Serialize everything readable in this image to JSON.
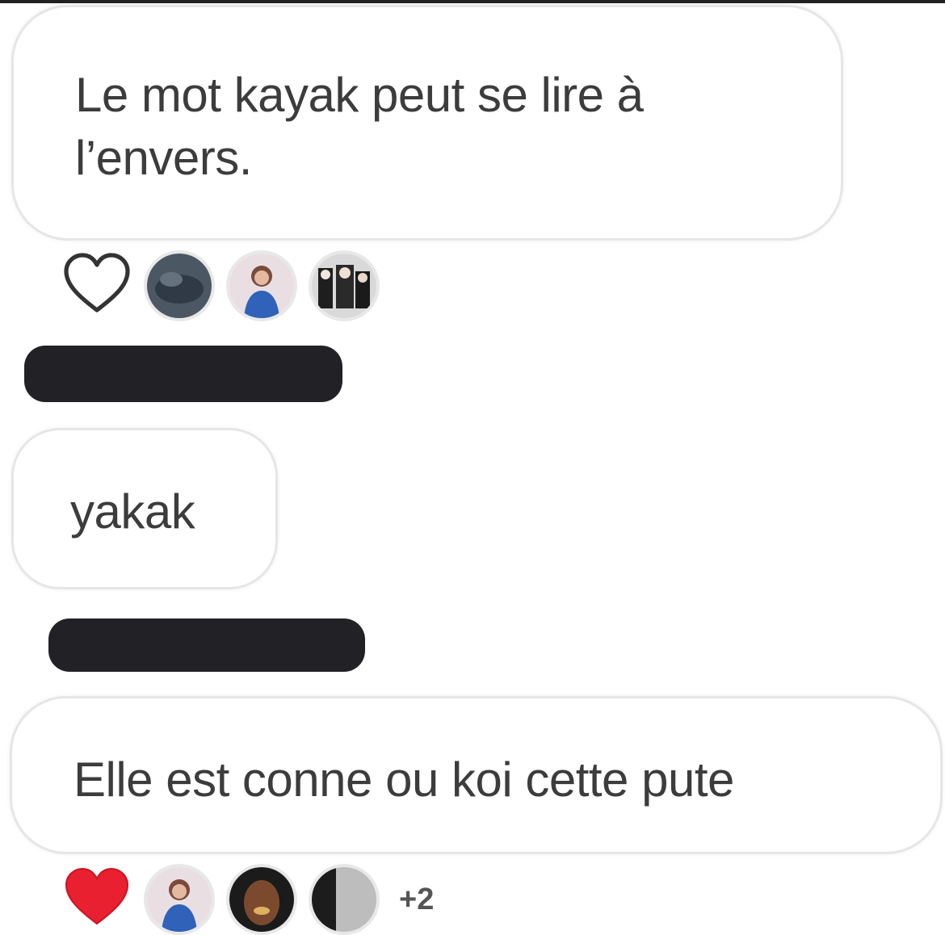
{
  "messages": [
    {
      "text": "Le mot kayak peut se lire à l’envers."
    },
    {
      "text": "yakak"
    },
    {
      "text": "Elle est conne ou koi cette pute"
    }
  ],
  "reactions": {
    "first": {
      "heart": "heart-outline-icon",
      "liked": false
    },
    "last": {
      "heart": "heart-filled-icon",
      "liked": true,
      "extra_count": "+2"
    }
  },
  "colors": {
    "heart_red": "#e8202f",
    "redaction": "#222226",
    "bubble_border": "#e6e6e6"
  }
}
